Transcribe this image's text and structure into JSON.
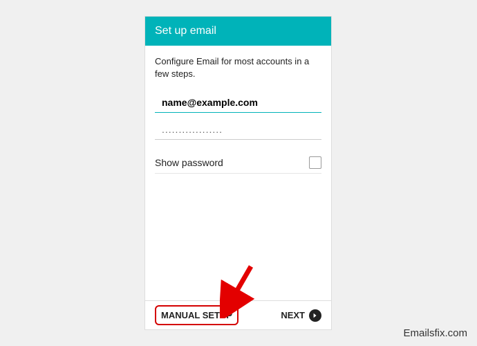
{
  "header": {
    "title": "Set up email"
  },
  "content": {
    "instruction": "Configure Email for most accounts in a few steps.",
    "email_value": "name@example.com",
    "password_mask": "..................",
    "show_password_label": "Show password"
  },
  "footer": {
    "manual_setup_label": "MANUAL SETUP",
    "next_label": "NEXT"
  },
  "watermark": "Emailsfix.com"
}
